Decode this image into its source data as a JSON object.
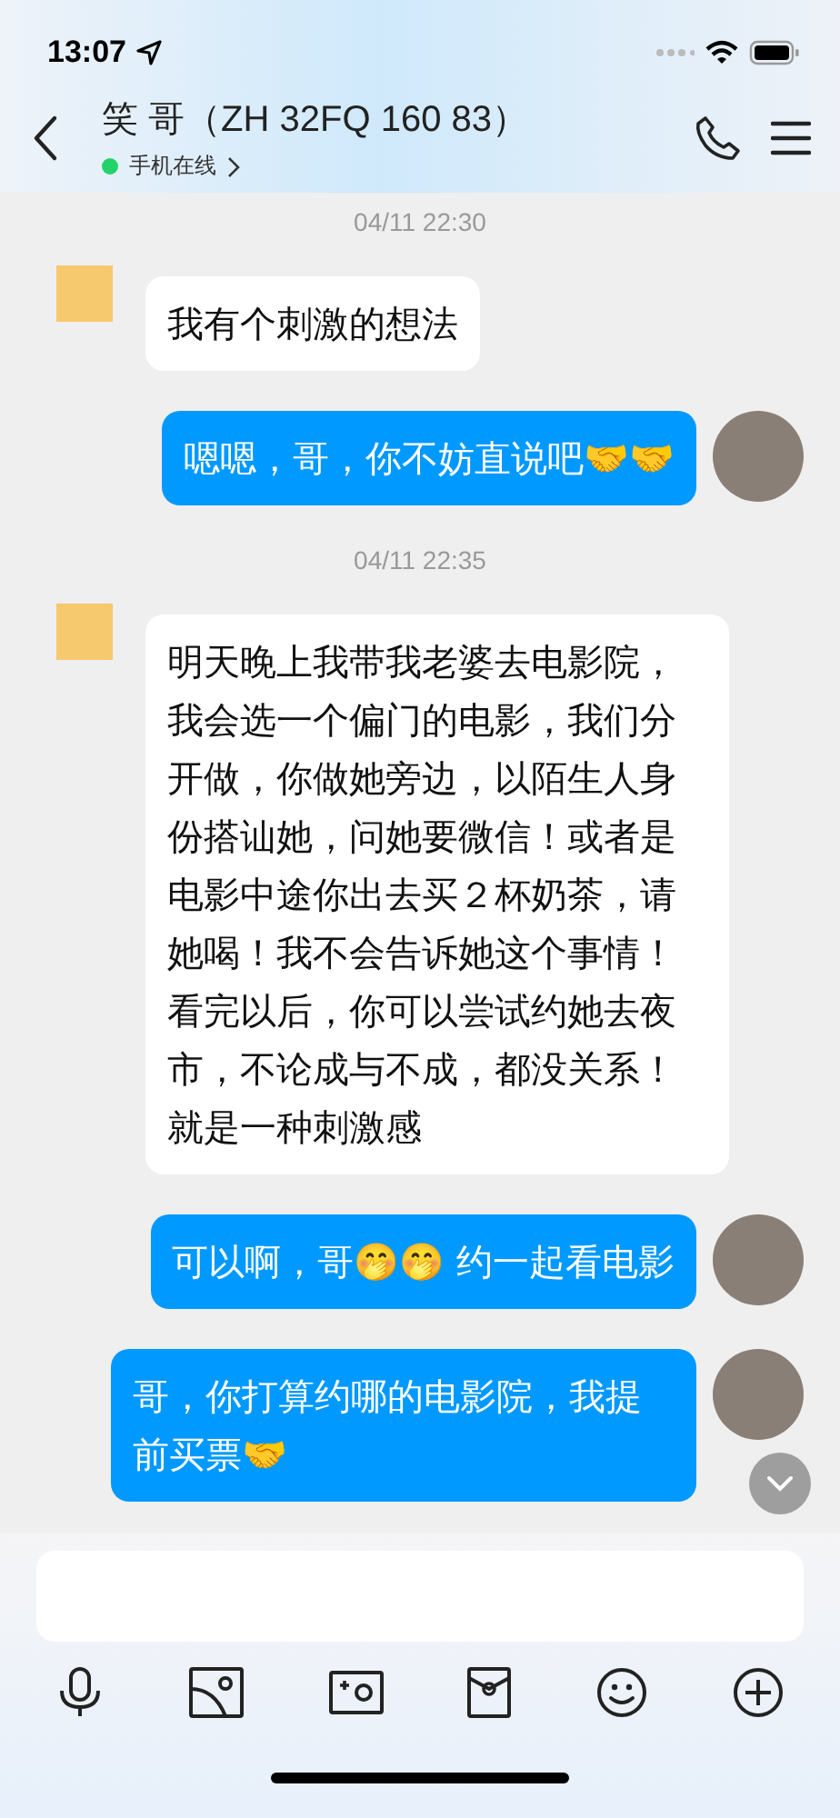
{
  "status_bar": {
    "time": "13:07"
  },
  "header": {
    "title": "笑 哥（ZH 32FQ 160 83）",
    "presence": "手机在线",
    "online": true
  },
  "messages": [
    {
      "kind": "time",
      "text": "04/11 22:30"
    },
    {
      "kind": "incoming",
      "text": "我有个刺激的想法"
    },
    {
      "kind": "outgoing",
      "text": "嗯嗯，哥，你不妨直说吧🤝🤝"
    },
    {
      "kind": "time",
      "text": "04/11 22:35"
    },
    {
      "kind": "incoming",
      "text": "明天晚上我带我老婆去电影院，我会选一个偏门的电影，我们分开做，你做她旁边，以陌生人身份搭讪她，问她要微信！或者是电影中途你出去买２杯奶茶，请她喝！我不会告诉她这个事情！看完以后，你可以尝试约她去夜市，不论成与不成，都没关系！就是一种刺激感"
    },
    {
      "kind": "outgoing",
      "text": "可以啊，哥🤭🤭 约一起看电影"
    },
    {
      "kind": "outgoing",
      "text": "哥，你打算约哪的电影院，我提前买票🤝"
    }
  ]
}
